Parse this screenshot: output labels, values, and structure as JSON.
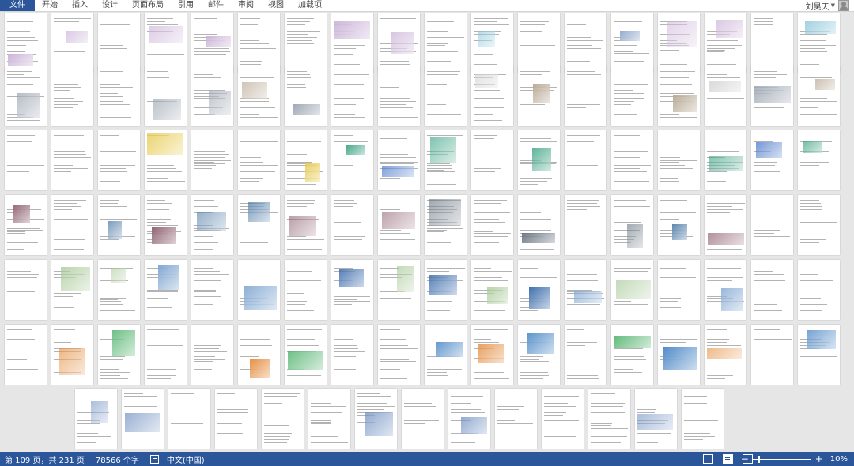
{
  "ribbon": {
    "tabs": [
      "文件",
      "开始",
      "插入",
      "设计",
      "页面布局",
      "引用",
      "邮件",
      "审阅",
      "视图",
      "加载项"
    ],
    "user_name": "刘昊天"
  },
  "status": {
    "page_info": "第 109 页，共 231 页",
    "word_count": "78566 个字",
    "language": "中文(中国)",
    "zoom": "10%",
    "zoom_minus": "−",
    "zoom_plus": "+"
  },
  "colors": {
    "accent": "#2b579a",
    "page_bg": "#ffffff",
    "workspace_bg": "#e6e6e6"
  },
  "icons": [
    "user-avatar-icon",
    "caret-down-icon",
    "document-check-icon",
    "read-mode-icon",
    "print-layout-icon",
    "web-layout-icon"
  ]
}
